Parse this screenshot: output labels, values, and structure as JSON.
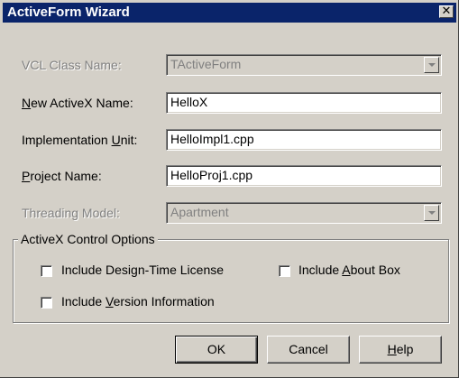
{
  "window": {
    "title": "ActiveForm Wizard",
    "close_glyph": "✕"
  },
  "form": {
    "vcl_class": {
      "label": "VCL Class Name:",
      "value": "TActiveForm",
      "enabled": false
    },
    "activex_name": {
      "label_pre": "",
      "label_key": "N",
      "label_post": "ew ActiveX Name:",
      "value": "HelloX"
    },
    "impl_unit": {
      "label_pre": "Implementation ",
      "label_key": "U",
      "label_post": "nit:",
      "value": "HelloImpl1.cpp"
    },
    "project_name": {
      "label_pre": "",
      "label_key": "P",
      "label_post": "roject Name:",
      "value": "HelloProj1.cpp"
    },
    "threading": {
      "label": "Threading Model:",
      "value": "Apartment",
      "enabled": false
    }
  },
  "options": {
    "title": "ActiveX Control Options",
    "design_license": {
      "label": "Include Design-Time License",
      "checked": false
    },
    "about_box": {
      "label_pre": "Include ",
      "label_key": "A",
      "label_post": "bout Box",
      "checked": false
    },
    "version_info": {
      "label_pre": "Include ",
      "label_key": "V",
      "label_post": "ersion Information",
      "checked": false
    }
  },
  "buttons": {
    "ok": "OK",
    "cancel": "Cancel",
    "help_key": "H",
    "help_post": "elp"
  },
  "colors": {
    "face": "#d4d0c8",
    "titlebar": "#0a246a",
    "disabled_text": "#808080"
  }
}
